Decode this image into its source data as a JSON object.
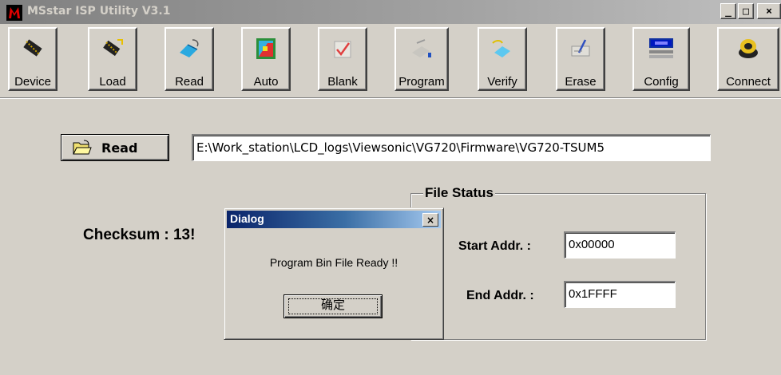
{
  "window": {
    "title": "MSstar ISP Utility V3.1",
    "controls": {
      "minimize": "_",
      "maximize": "□",
      "close": "×"
    }
  },
  "toolbar": {
    "buttons": [
      {
        "label": "Device",
        "icon": "chip-icon"
      },
      {
        "label": "Load",
        "icon": "chip-load-icon"
      },
      {
        "label": "Read",
        "icon": "read-icon"
      },
      {
        "label": "Auto",
        "icon": "auto-icon"
      },
      {
        "label": "Blank",
        "icon": "blank-check-icon"
      },
      {
        "label": "Program",
        "icon": "program-icon"
      },
      {
        "label": "Verify",
        "icon": "verify-icon"
      },
      {
        "label": "Erase",
        "icon": "erase-icon"
      },
      {
        "label": "Config",
        "icon": "config-icon"
      },
      {
        "label": "Connect",
        "icon": "connect-icon"
      }
    ]
  },
  "main": {
    "read_button_label": "Read",
    "file_path": "E:\\Work_station\\LCD_logs\\Viewsonic\\VG720\\Firmware\\VG720-TSUM5",
    "checksum_label": "Checksum : 13!",
    "file_status": {
      "title": "File Status",
      "start_label": "Start Addr. :",
      "start_value": "0x00000",
      "end_label": "End Addr. :",
      "end_value": "0x1FFFF"
    }
  },
  "dialog": {
    "title": "Dialog",
    "close": "×",
    "message": "Program Bin File Ready !!",
    "ok_label": "确定"
  },
  "colors": {
    "face": "#d4d0c8",
    "inactive_title": "#808080",
    "dialog_title": "#0a246a"
  }
}
